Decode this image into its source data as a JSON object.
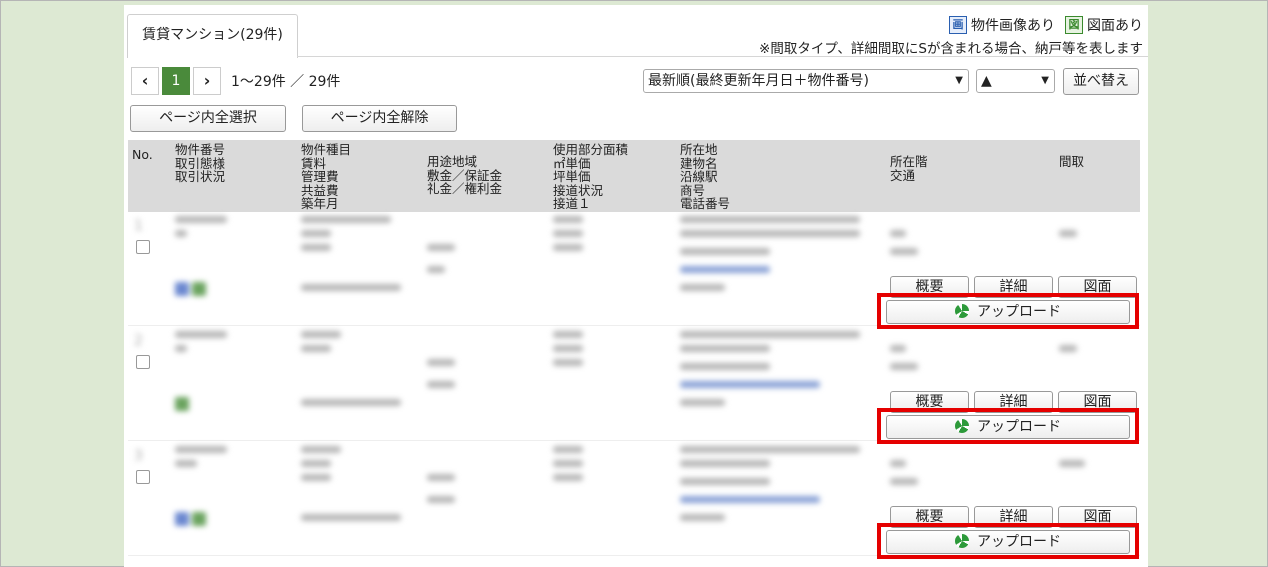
{
  "tab": {
    "label": "賃貸マンション(29件)"
  },
  "legend": {
    "image_icon_char": "画",
    "image_label": "物件画像あり",
    "plan_icon_char": "図",
    "plan_label": "図面あり",
    "note": "※間取タイプ、詳細間取にSが含まれる場合、納戸等を表します"
  },
  "pager": {
    "prev": "‹",
    "current": "1",
    "next": "›",
    "info": "1〜29件 ／ 29件"
  },
  "sort": {
    "order_value": "最新順(最終更新年月日＋物件番号)",
    "direction_value": "▲",
    "sort_button": "並べ替え"
  },
  "page_actions": {
    "select_all": "ページ内全選択",
    "deselect_all": "ページ内全解除"
  },
  "table": {
    "headers": {
      "no": "No.",
      "col1": "物件番号\n取引態様\n取引状況",
      "col2": "物件種目\n賃料\n管理費\n共益費\n築年月",
      "col3": "用途地域\n敷金／保証金\n礼金／権利金",
      "col4": "使用部分面積\n㎡単価\n坪単価\n接道状況\n接道１",
      "col5": "所在地\n建物名\n沿線駅\n商号\n電話番号",
      "col6": "所在階\n交通",
      "col7": "間取"
    },
    "rows": [
      {
        "no": "1",
        "summary": "概要",
        "detail": "詳細",
        "plan": "図面",
        "upload": "アップロード"
      },
      {
        "no": "2",
        "summary": "概要",
        "detail": "詳細",
        "plan": "図面",
        "upload": "アップロード"
      },
      {
        "no": "3",
        "summary": "概要",
        "detail": "詳細",
        "plan": "図面",
        "upload": "アップロード"
      }
    ]
  },
  "colors": {
    "background": "#dde9d3",
    "pager_current": "#4a8a3b",
    "highlight": "#e50000",
    "image_badge": "#2a5fb0",
    "plan_badge": "#3b8a2e"
  }
}
